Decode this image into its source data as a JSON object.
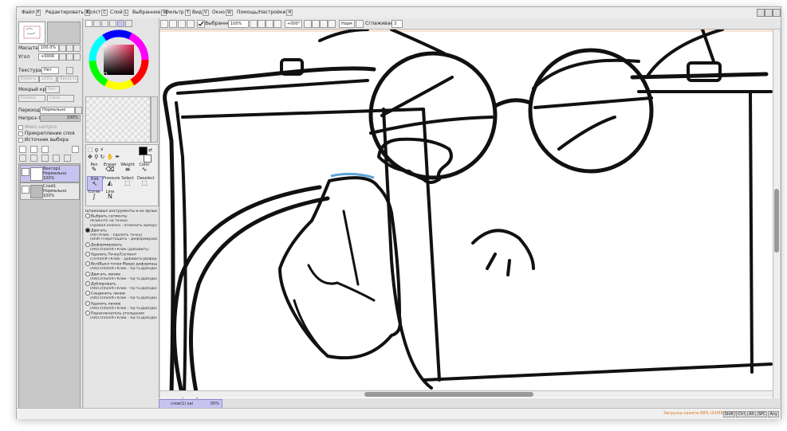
{
  "menu": [
    {
      "label": "Файл",
      "key": "F"
    },
    {
      "label": "Редактировать",
      "key": "E"
    },
    {
      "label": "Холст",
      "key": "C"
    },
    {
      "label": "Слой",
      "key": "L"
    },
    {
      "label": "Выбранное",
      "key": "S"
    },
    {
      "label": "Фильтр",
      "key": "T"
    },
    {
      "label": "Вид",
      "key": "V"
    },
    {
      "label": "Окно",
      "key": "W"
    },
    {
      "label": "Помощь/Настройки",
      "key": "H"
    }
  ],
  "toolbar": {
    "selected_label": "Выбранное",
    "zoom": "100%",
    "rotation": "+000°",
    "stabilizer_mode": "Норм",
    "stabilizer_label": "Сглаживание",
    "stabilizer_value": "3"
  },
  "left": {
    "zoom_label": "Масштаб",
    "zoom_value": "100.0%",
    "angle_label": "Угол",
    "angle_value": "+000R",
    "texture_label": "Текстура",
    "texture_value": "Нет",
    "texture_sub1": "Бумага",
    "texture_sub1_val": "100%",
    "texture_sub1_v2": "Яркость",
    "wet_label": "Мокрый край",
    "wet_value": "Нет",
    "wet_sub": "Размер",
    "wet_sub_v": "Сила",
    "blend_label": "Переход",
    "blend_value": "Нормально",
    "opacity_label": "Непроз-ть",
    "opacity_value": "100%",
    "protect_label": "Фикс.непроз.",
    "clip_label": "Прикрепление слоя",
    "source_label": "Источник выбора"
  },
  "layers": [
    {
      "name": "Вектор1",
      "mode": "Нормально",
      "opacity": "100%",
      "selected": true
    },
    {
      "name": "Слой1",
      "mode": "Нормально",
      "opacity": "100%",
      "selected": false
    }
  ],
  "tools": {
    "row1": [
      {
        "label": "Pen",
        "icon": "✎"
      },
      {
        "label": "Eraser",
        "icon": "⌫"
      },
      {
        "label": "Weight",
        "icon": "≡"
      },
      {
        "label": "Color",
        "icon": "∿"
      }
    ],
    "row2": [
      {
        "label": "Edit",
        "icon": "↖"
      },
      {
        "label": "Pressure",
        "icon": "◭"
      },
      {
        "label": "Select",
        "icon": "⬚"
      },
      {
        "label": "Deselect",
        "icon": "⬚"
      }
    ],
    "row3": [
      {
        "label": "Curve",
        "icon": "∫"
      },
      {
        "label": "Line",
        "icon": "N"
      }
    ]
  },
  "help": {
    "header": "Штриховые инструменты и их ярлыки",
    "items": [
      {
        "t": "Выбрать сегменты",
        "radio": false
      },
      {
        "t": "(Кликнте на точки)",
        "sub": true
      },
      {
        "t": "(Правая кнопка - отменить выбор)",
        "sub": true
      },
      {
        "t": "Двигать",
        "radio": true,
        "on": true
      },
      {
        "t": "(Alt+Клик - Удалить точку)",
        "sub": true
      },
      {
        "t": "(Shift+Перетащить - Деформировать)",
        "sub": true
      },
      {
        "t": "Деформировать",
        "radio": true
      },
      {
        "t": "(Alt/Ctrl/Shift+Клик (Добавить)",
        "sub": true
      },
      {
        "t": "Удалить Точку/Сегмент",
        "radio": true
      },
      {
        "t": "(Ctrl/Shift+Клик - Добавить)Деформир",
        "sub": true
      },
      {
        "t": "Вкл/Выкл точки Макро деформации",
        "radio": true
      },
      {
        "t": "(Alt/Ctrl/Shift+Клик - Уд-ть)Доб)Деф-",
        "sub": true
      },
      {
        "t": "Двигать линию",
        "radio": true
      },
      {
        "t": "(Alt/Ctrl/Shift+Клик - Уд-ть)Доб)Деф-",
        "sub": true
      },
      {
        "t": "Дублировать",
        "radio": true
      },
      {
        "t": "(Alt/Ctrl/Shift+Клик - Уд-ть)Доб)Деф-",
        "sub": true
      },
      {
        "t": "Соединить линии",
        "radio": true
      },
      {
        "t": "(Alt/Ctrl/Shift+Клик - Уд-ть)Доб)Деф-",
        "sub": true
      },
      {
        "t": "Удалить линию",
        "radio": true
      },
      {
        "t": "(Alt/Ctrl/Shift+Клик - Уд-ть)Доб)Деф-",
        "sub": true
      },
      {
        "t": "Переключатель утолщения",
        "radio": true
      },
      {
        "t": "(Alt/Ctrl/Shift+Клик - Уд-ть)Доб)Деф-",
        "sub": true
      }
    ]
  },
  "document_tab": {
    "name": "слои(1).sai",
    "zoom": "00%"
  },
  "status": {
    "memory": "Загрузка памяти 88% (91MB / 755MB)",
    "keys": [
      "Shift",
      "Ctrl",
      "Alt",
      "SPC"
    ],
    "any": "Any"
  },
  "colors": {
    "accent": "#c7c3f0",
    "line": "#111111",
    "memory": "#e07a1c"
  }
}
